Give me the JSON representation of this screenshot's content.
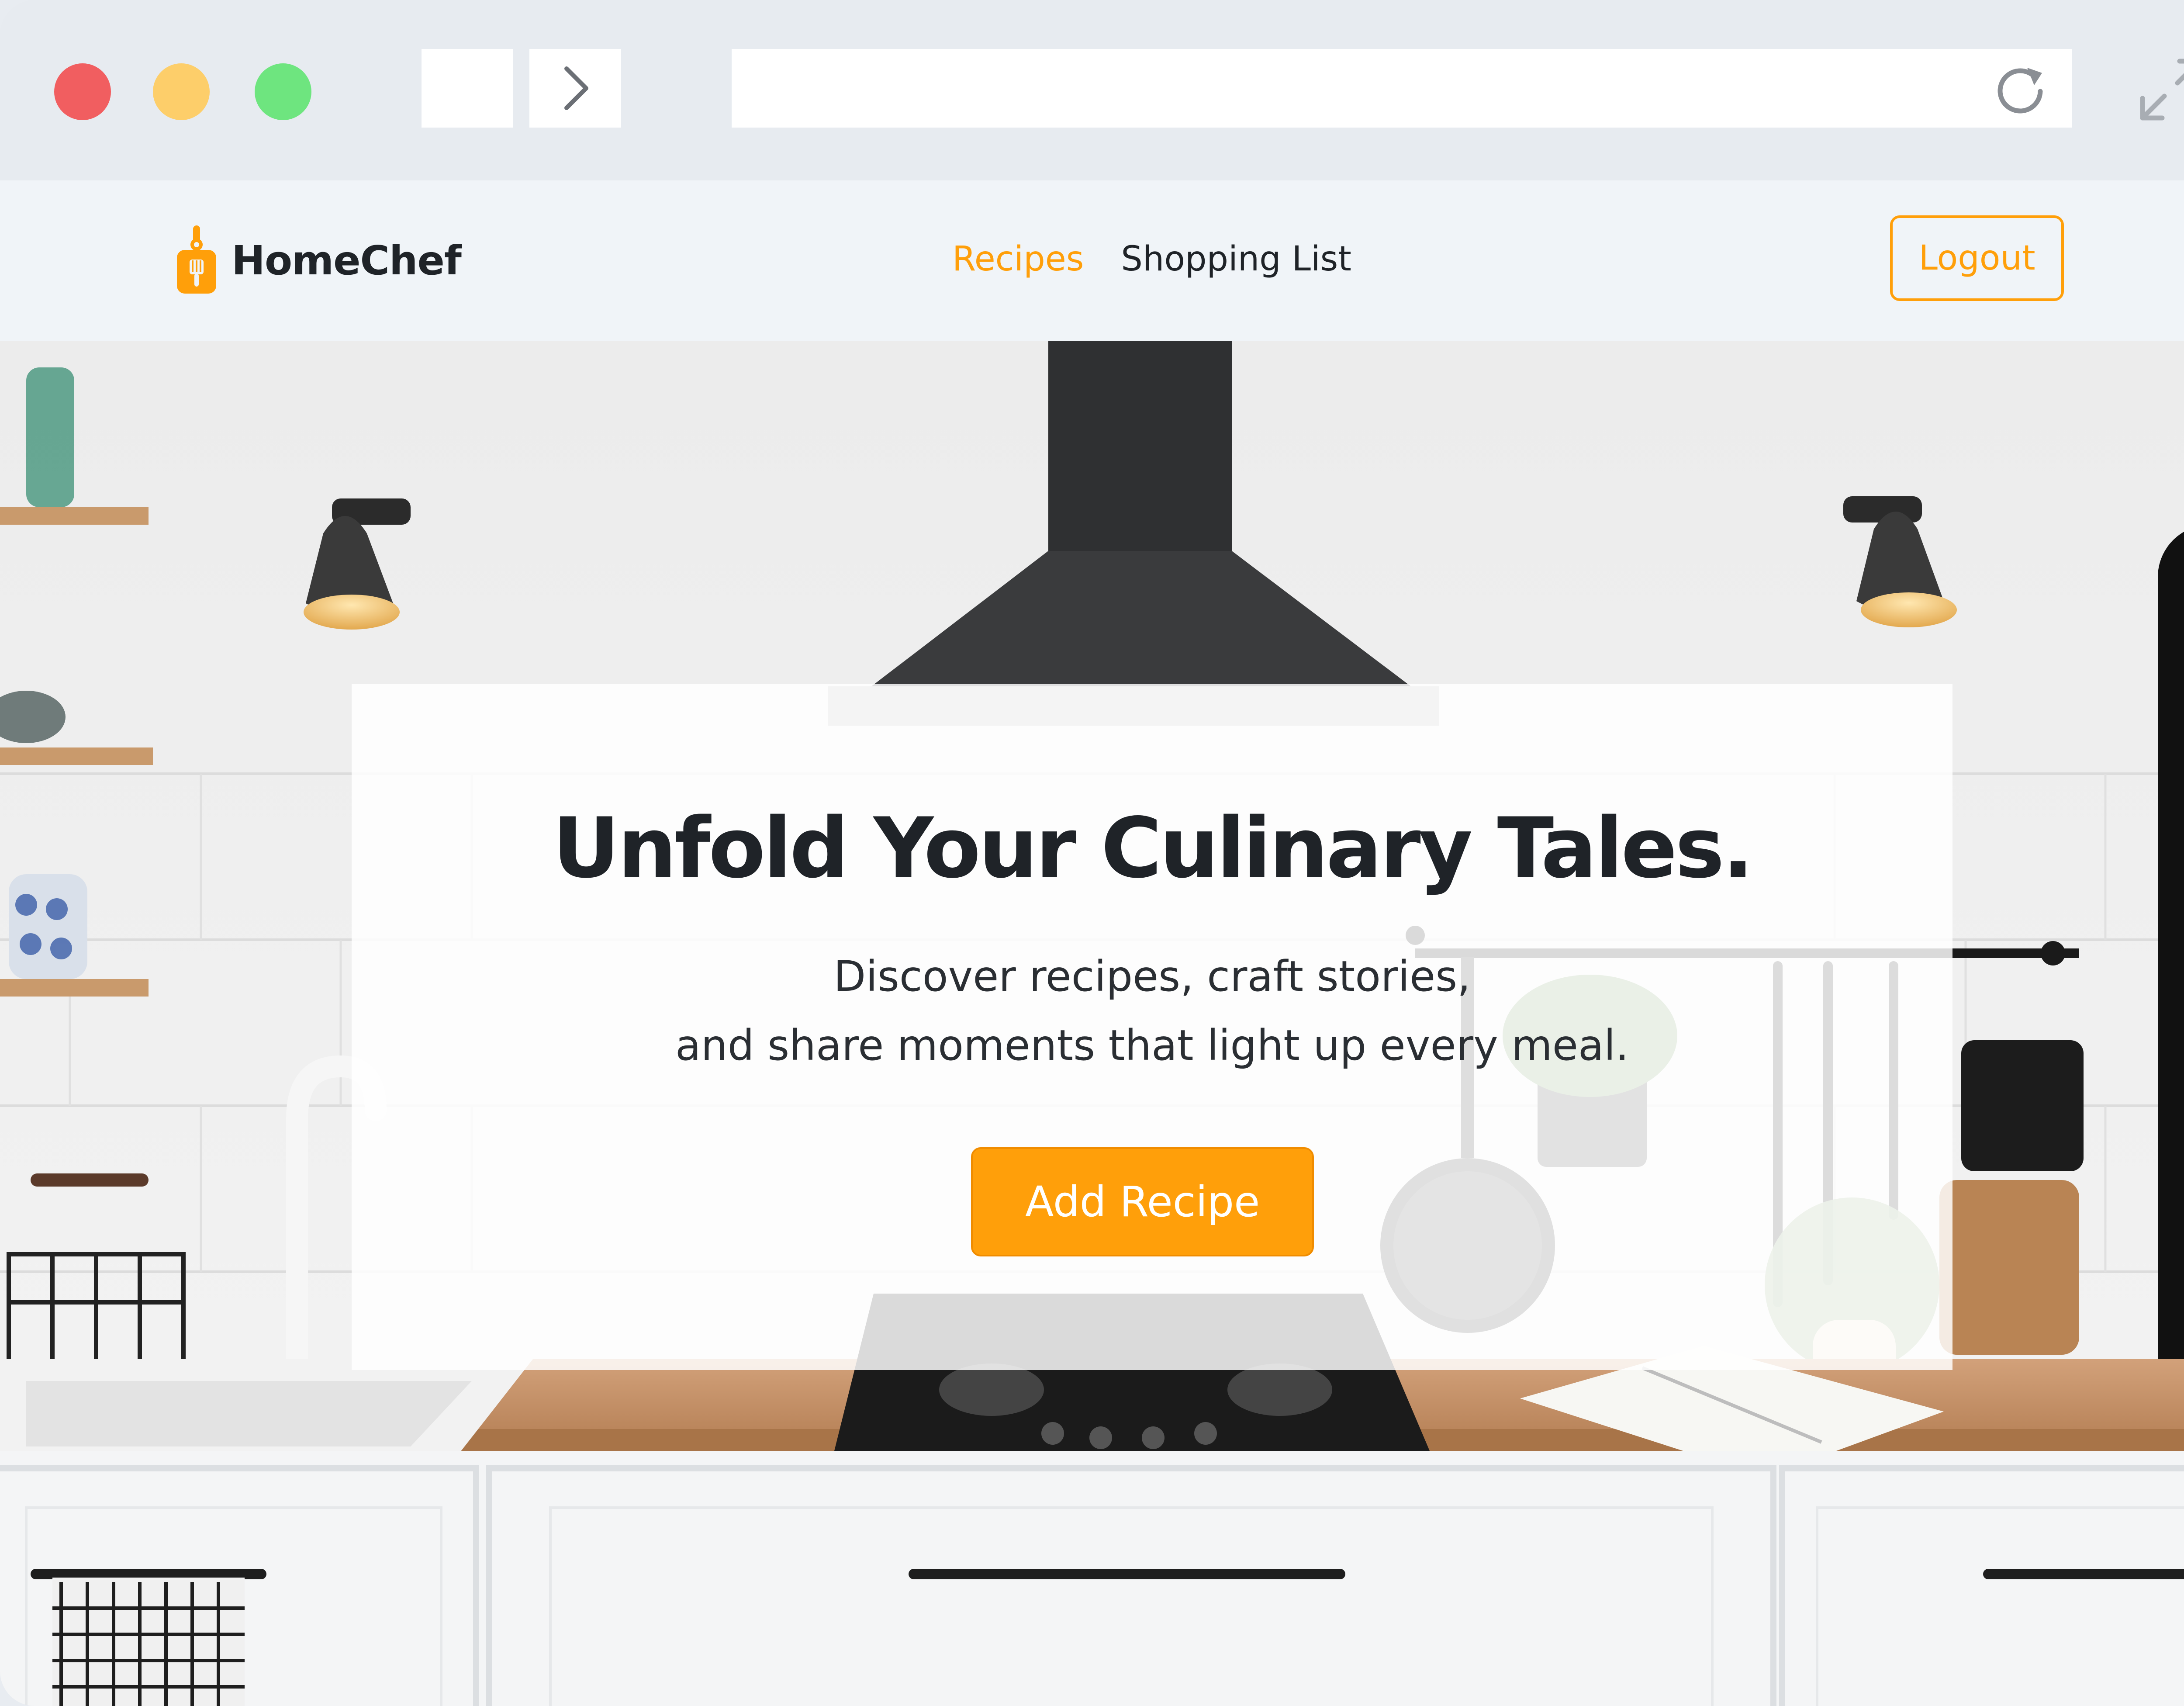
{
  "brand": {
    "name": "HomeChef",
    "logo_icon": "chef-board-icon",
    "accent": "#ff9f0a"
  },
  "nav": {
    "links": [
      {
        "label": "Recipes",
        "active": true
      },
      {
        "label": "Shopping List",
        "active": false
      }
    ],
    "logout_label": "Logout"
  },
  "hero": {
    "title": "Unfold Your Culinary Tales.",
    "subtitle_line1": "Discover recipes, craft stories,",
    "subtitle_line2": "and share moments that light up every meal.",
    "cta_label": "Add Recipe"
  },
  "browser": {
    "url": "",
    "icons": [
      "back-icon",
      "forward-icon",
      "reload-icon",
      "expand-icon"
    ]
  }
}
